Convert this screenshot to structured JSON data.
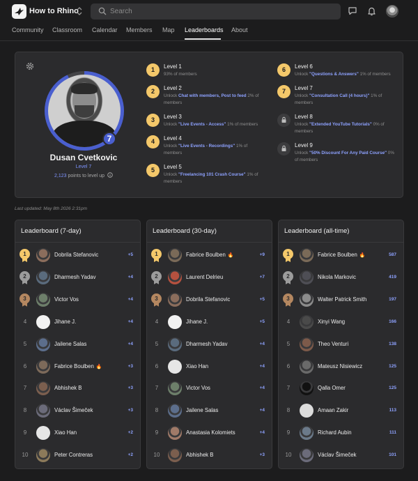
{
  "app": {
    "title": "How to Rhino"
  },
  "search": {
    "placeholder": "Search"
  },
  "nav": {
    "items": [
      {
        "label": "Community"
      },
      {
        "label": "Classroom"
      },
      {
        "label": "Calendar"
      },
      {
        "label": "Members"
      },
      {
        "label": "Map"
      },
      {
        "label": "Leaderboards",
        "active": true
      },
      {
        "label": "About"
      }
    ]
  },
  "profile": {
    "name": "Dusan Cvetkovic",
    "level_label": "Level 7",
    "level_number": "7",
    "points": "2,123",
    "points_suffix": " points to level up",
    "progress_fraction": 0.93
  },
  "levels": [
    {
      "badge": "1",
      "title": "Level 1",
      "pre": "",
      "hl": "",
      "post": "93% of members",
      "locked": false
    },
    {
      "badge": "2",
      "title": "Level 2",
      "pre": "Unlock ",
      "hl": "Chat with members, Post to feed",
      "post": " 2% of members",
      "locked": false
    },
    {
      "badge": "3",
      "title": "Level 3",
      "pre": "Unlock ",
      "hl": "\"Live Events - Access\"",
      "post": " 1% of members",
      "locked": false
    },
    {
      "badge": "4",
      "title": "Level 4",
      "pre": "Unlock ",
      "hl": "\"Live Events - Recordings\"",
      "post": " 1% of members",
      "locked": false
    },
    {
      "badge": "5",
      "title": "Level 5",
      "pre": "Unlock ",
      "hl": "\"Freelancing 101 Crash Course\"",
      "post": " 1% of members",
      "locked": false
    },
    {
      "badge": "6",
      "title": "Level 6",
      "pre": "Unlock ",
      "hl": "\"Questions & Answers\"",
      "post": " 1% of members",
      "locked": false
    },
    {
      "badge": "7",
      "title": "Level 7",
      "pre": "Unlock ",
      "hl": "\"Consultation Call (4 hours)\"",
      "post": " 1% of members",
      "locked": false
    },
    {
      "badge": "",
      "title": "Level 8",
      "pre": "Unlock ",
      "hl": "\"Extended YouTube Tutorials\"",
      "post": " 0% of members",
      "locked": true
    },
    {
      "badge": "",
      "title": "Level 9",
      "pre": "Unlock ",
      "hl": "\"50% Discount For Any Paid Course\"",
      "post": " 0% of members",
      "locked": true
    }
  ],
  "last_updated": "Last updated: May 8th 2026 2:31pm",
  "leaderboards": [
    {
      "title": "Leaderboard (7-day)",
      "rows": [
        {
          "rank": "1",
          "name": "Dobrila Stefanovic",
          "fire": "",
          "points": "+5"
        },
        {
          "rank": "2",
          "name": "Dharmesh Yadav",
          "fire": "",
          "points": "+4"
        },
        {
          "rank": "3",
          "name": "Victor Vos",
          "fire": "",
          "points": "+4"
        },
        {
          "rank": "4",
          "name": "Jihane J.",
          "fire": "",
          "points": "+4"
        },
        {
          "rank": "5",
          "name": "Jailene Salas",
          "fire": "",
          "points": "+4"
        },
        {
          "rank": "6",
          "name": "Fabrice Boulben",
          "fire": "🔥",
          "points": "+3"
        },
        {
          "rank": "7",
          "name": "Abhishek B",
          "fire": "",
          "points": "+3"
        },
        {
          "rank": "8",
          "name": "Václav Šimeček",
          "fire": "",
          "points": "+3"
        },
        {
          "rank": "9",
          "name": "Xiao Han",
          "fire": "",
          "points": "+2"
        },
        {
          "rank": "10",
          "name": "Peter Contreras",
          "fire": "",
          "points": "+2"
        }
      ]
    },
    {
      "title": "Leaderboard (30-day)",
      "rows": [
        {
          "rank": "1",
          "name": "Fabrice Boulben",
          "fire": "🔥",
          "points": "+9"
        },
        {
          "rank": "2",
          "name": "Laurent Delrieu",
          "fire": "",
          "points": "+7"
        },
        {
          "rank": "3",
          "name": "Dobrila Stefanovic",
          "fire": "",
          "points": "+5"
        },
        {
          "rank": "4",
          "name": "Jihane J.",
          "fire": "",
          "points": "+5"
        },
        {
          "rank": "5",
          "name": "Dharmesh Yadav",
          "fire": "",
          "points": "+4"
        },
        {
          "rank": "6",
          "name": "Xiao Han",
          "fire": "",
          "points": "+4"
        },
        {
          "rank": "7",
          "name": "Victor Vos",
          "fire": "",
          "points": "+4"
        },
        {
          "rank": "8",
          "name": "Jailene Salas",
          "fire": "",
          "points": "+4"
        },
        {
          "rank": "9",
          "name": "Anastasia Kolomiets",
          "fire": "",
          "points": "+4"
        },
        {
          "rank": "10",
          "name": "Abhishek B",
          "fire": "",
          "points": "+3"
        }
      ]
    },
    {
      "title": "Leaderboard (all-time)",
      "rows": [
        {
          "rank": "1",
          "name": "Fabrice Boulben",
          "fire": "🔥",
          "points": "587"
        },
        {
          "rank": "2",
          "name": "Nikola Markovic",
          "fire": "",
          "points": "419"
        },
        {
          "rank": "3",
          "name": "Walter Patrick Smith",
          "fire": "",
          "points": "197"
        },
        {
          "rank": "4",
          "name": "Xinyi Wang",
          "fire": "",
          "points": "166"
        },
        {
          "rank": "5",
          "name": "Theo Venturi",
          "fire": "",
          "points": "138"
        },
        {
          "rank": "6",
          "name": "Mateusz Nisiewicz",
          "fire": "",
          "points": "125"
        },
        {
          "rank": "7",
          "name": "Qalla Omer",
          "fire": "",
          "points": "125"
        },
        {
          "rank": "8",
          "name": "Amaan Zakir",
          "fire": "",
          "points": "113"
        },
        {
          "rank": "9",
          "name": "Richard Aubin",
          "fire": "",
          "points": "111"
        },
        {
          "rank": "10",
          "name": "Václav Šimeček",
          "fire": "",
          "points": "101"
        }
      ]
    }
  ],
  "colors": {
    "accent": "#4a5fcf",
    "link": "#8ea2ff",
    "gold": "#f4c86a",
    "silver": "#9c9c9c",
    "bronze": "#b48760",
    "card": "#2b2b2d",
    "background": "#1c1c1d"
  },
  "icons": {
    "logo": "rhino-bird-icon",
    "switch": "chevron-up-down-icon",
    "search": "search-icon",
    "chat": "chat-icon",
    "notifications": "bell-icon",
    "settings": "gear-icon",
    "locked": "lock-icon",
    "info": "info-circle-icon"
  }
}
